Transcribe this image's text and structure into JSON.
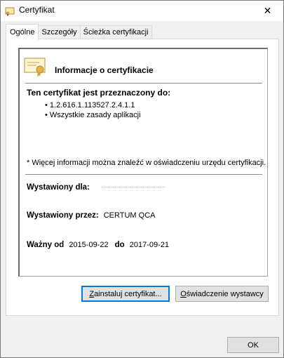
{
  "window": {
    "title": "Certyfikat",
    "close_glyph": "✕"
  },
  "tabs": [
    {
      "label": "Ogólne"
    },
    {
      "label": "Szczegóły"
    },
    {
      "label": "Ścieżka certyfikacji"
    }
  ],
  "info": {
    "header": "Informacje o certyfikacie",
    "purpose_title": "Ten certyfikat jest przeznaczony do:",
    "purposes": [
      "1.2.616.1.113527.2.4.1.1",
      "Wszystkie zasady aplikacji"
    ],
    "footnote": "* Więcej informacji można znaleźć w oświadczeniu urzędu certyfikacji.",
    "issued_to_label": "Wystawiony dla:",
    "issued_to_value": "",
    "issued_by_label": "Wystawiony przez:",
    "issued_by_value": "CERTUM QCA",
    "valid_from_label": "Ważny od",
    "valid_from": "2015-09-22",
    "valid_to_label": "do",
    "valid_to": "2017-09-21"
  },
  "buttons": {
    "install_prefix": "Z",
    "install_rest": "ainstaluj certyfikat...",
    "statement_prefix": "O",
    "statement_rest": "świadczenie wystawcy",
    "ok": "OK"
  },
  "icons": {
    "title": "certificate-icon",
    "cert": "certificate-ribbon-icon",
    "close": "close-icon"
  },
  "colors": {
    "accent": "#0078d7",
    "cert_gold": "#d8a23b"
  }
}
